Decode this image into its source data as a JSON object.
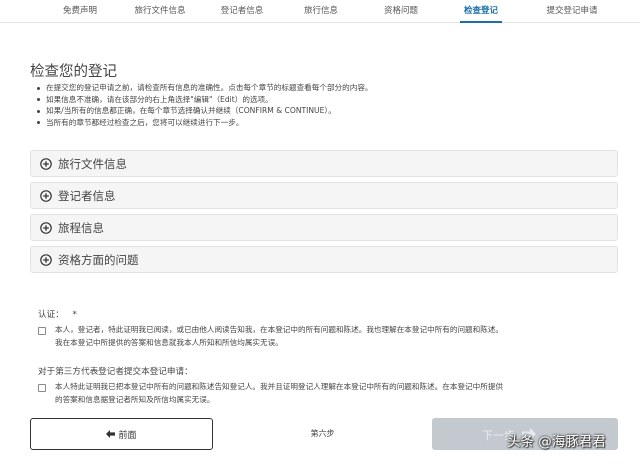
{
  "nav": {
    "tabs": [
      {
        "label": "免费声明",
        "active": false
      },
      {
        "label": "旅行文件信息",
        "active": false
      },
      {
        "label": "登记者信息",
        "active": false
      },
      {
        "label": "旅行信息",
        "active": false
      },
      {
        "label": "资格问题",
        "active": false
      },
      {
        "label": "检查登记",
        "active": true
      },
      {
        "label": "提交登记申请",
        "active": false
      }
    ]
  },
  "page": {
    "title": "检查您的登记",
    "instructions": [
      "在提交您的登记申请之前，请检查所有信息的准确性。点击每个章节的标题查看每个部分的内容。",
      "如果信息不准确，请在该部分的右上角选择\"编辑\"（Edit）的选项。",
      "如果/当所有的信息都正确，在每个章节选择确认并继续（CONFIRM & CONTINUE）。",
      "当所有的章节都经过检查之后，您将可以继续进行下一步。"
    ]
  },
  "sections": [
    {
      "label": "旅行文件信息"
    },
    {
      "label": "登记者信息"
    },
    {
      "label": "旅程信息"
    },
    {
      "label": "资格方面的问题"
    }
  ],
  "certification": {
    "label": "认证：",
    "required_mark": "*",
    "statement": [
      "本人，登记者，特此证明我已阅读，或已由他人阅读告知我，在本登记中的所有问题和陈述。我也理解在本登记中所有的问题和陈述。",
      "我在本登记中所提供的答案和信息就我本人所知和所信均属实无误。"
    ],
    "checked": false
  },
  "third_party": {
    "label": "对于第三方代表登记者提交本登记申请：",
    "statement": [
      "本人特此证明我已把本登记中所有的问题和陈述告知登记人。我并且证明登记人理解在本登记中所有的问题和陈述。在本登记中所提供",
      "的答案和信息据登记者所知及所信均属实无误。"
    ],
    "checked": false
  },
  "footer": {
    "prev_label": "前面",
    "step_label": "第六步",
    "next_label": "下一步"
  },
  "watermark": "头条 @海豚君君",
  "colors": {
    "accent": "#1a6fa8",
    "section_bg": "#f5f5f5",
    "next_button_disabled": "#c4c9cf"
  },
  "icons": {
    "section_toggle": "plus-circle-icon",
    "prev": "arrow-left-icon",
    "next": "arrow-right-icon"
  }
}
